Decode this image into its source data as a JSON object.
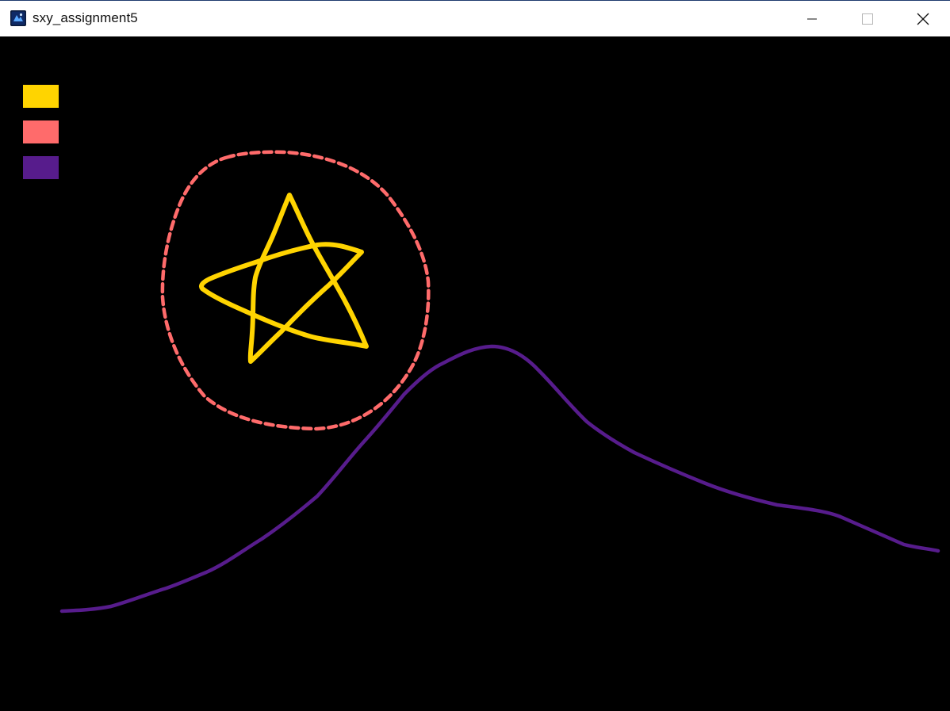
{
  "window": {
    "title": "sxy_assignment5",
    "icon": "app-icon",
    "controls": [
      "minimize-icon",
      "maximize-icon",
      "close-icon"
    ]
  },
  "palette": {
    "colors": [
      {
        "name": "yellow",
        "hex": "#ffd400"
      },
      {
        "name": "coral",
        "hex": "#ff6b6b"
      },
      {
        "name": "purple",
        "hex": "#571c8c"
      }
    ]
  },
  "drawing": {
    "background": "#000000",
    "strokes": [
      {
        "shape": "circle",
        "color": "#ff6b6b",
        "style": "dashed"
      },
      {
        "shape": "star",
        "color": "#ffd400",
        "style": "solid"
      },
      {
        "shape": "mountain-curve",
        "color": "#571c8c",
        "style": "solid"
      }
    ]
  }
}
